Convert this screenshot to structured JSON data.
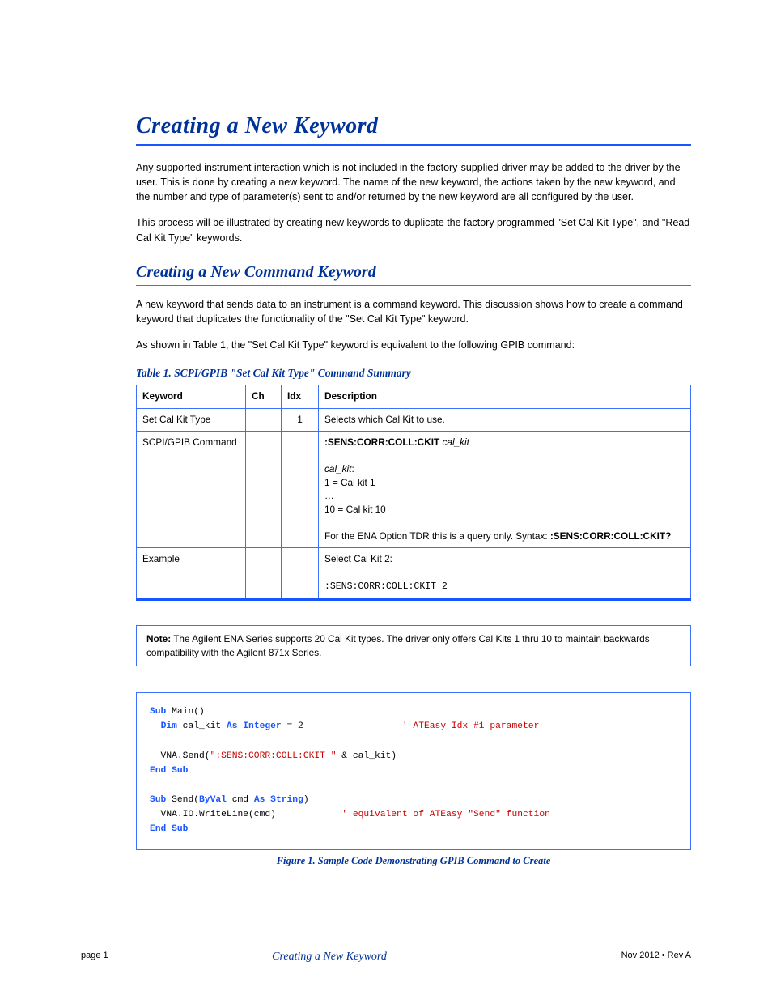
{
  "section_title": "Creating a New Keyword",
  "intro_paragraphs": [
    "Any supported instrument interaction which is not included in the factory-supplied driver may be added to the driver by the user. This is done by creating a new keyword. The name of the new keyword, the actions taken by the new keyword, and the number and type of parameter(s) sent to and/or returned by the new keyword are all configured by the user.",
    "This process will be illustrated by creating new keywords to duplicate the factory programmed \"Set Cal Kit Type\", and \"Read Cal Kit Type\" keywords."
  ],
  "subheading": "Creating a New Command Keyword",
  "sub_paragraph": "A new keyword that sends data to an instrument is a command keyword. This discussion shows how to create a command keyword that duplicates the functionality of the \"Set Cal Kit Type\" keyword.",
  "sub_paragraph2_prefix": "As shown in ",
  "sub_paragraph2_link": "Table 1",
  "sub_paragraph2_suffix": ", the \"Set Cal Kit Type\" keyword is equivalent to the following GPIB command:",
  "table_title": "Table 1. SCPI/GPIB \"Set Cal Kit Type\" Command Summary",
  "table": {
    "headers": [
      "Keyword",
      "Ch",
      "Idx",
      "Description"
    ],
    "rows": [
      {
        "kw": "Set Cal Kit Type",
        "ch": "",
        "idx": "1",
        "desc": "Selects which Cal Kit to use."
      },
      {
        "kw": "  SCPI/GPIB Command",
        "ch": "",
        "idx": "",
        "desc": "<b>:SENS:CORR:COLL:CKIT</b> <i>cal_kit</i><br><br><i>cal_kit</i>:<br>1 = Cal kit 1<br>…<br>10 = Cal kit 10<br><br>For the ENA Option TDR this is a query only. Syntax: <b>:SENS:CORR:COLL:CKIT?</b>"
      },
      {
        "kw": "  Example",
        "ch": "",
        "idx": "",
        "desc": "Select Cal Kit 2:<br><br><span class=\"code\">:SENS:CORR:COLL:CKIT 2</span>"
      }
    ]
  },
  "note_label": "Note:",
  "note_text": " The Agilent ENA Series supports 20 Cal Kit types. The driver only offers Cal Kits 1 thru 10 to maintain backwards compatibility with the Agilent 871x Series.",
  "code_lines": [
    {
      "segments": [
        {
          "t": "Sub",
          "c": "kw-blue"
        },
        {
          "t": " Main()"
        }
      ]
    },
    {
      "segments": [
        {
          "t": "  "
        },
        {
          "t": "Dim",
          "c": "kw-blue"
        },
        {
          "t": " cal_kit "
        },
        {
          "t": "As Integer",
          "c": "kw-blue"
        },
        {
          "t": " = 2                  "
        },
        {
          "t": "' ATEasy Idx #1 parameter",
          "c": "str-red"
        }
      ]
    },
    {
      "segments": [
        {
          "t": ""
        }
      ]
    },
    {
      "segments": [
        {
          "t": "  VNA.Send("
        },
        {
          "t": "\":SENS:CORR:COLL:CKIT \"",
          "c": "str-red"
        },
        {
          "t": " & cal_kit)"
        }
      ]
    },
    {
      "segments": [
        {
          "t": "End Sub",
          "c": "kw-blue"
        }
      ]
    },
    {
      "segments": [
        {
          "t": ""
        }
      ]
    },
    {
      "segments": [
        {
          "t": "Sub",
          "c": "kw-blue"
        },
        {
          "t": " Send("
        },
        {
          "t": "ByVal",
          "c": "kw-blue"
        },
        {
          "t": " cmd "
        },
        {
          "t": "As String",
          "c": "kw-blue"
        },
        {
          "t": ")"
        }
      ]
    },
    {
      "segments": [
        {
          "t": "  VNA.IO.WriteLine(cmd)            "
        },
        {
          "t": "' equivalent of ATEasy \"Send\" function",
          "c": "str-red"
        }
      ]
    },
    {
      "segments": [
        {
          "t": "End Sub",
          "c": "kw-blue"
        }
      ]
    }
  ],
  "code_caption": "Figure 1. Sample Code Demonstrating GPIB Command to Create",
  "footer": {
    "left": "page 1",
    "mid": "Creating a New Keyword",
    "right": "Nov 2012 • Rev A"
  }
}
